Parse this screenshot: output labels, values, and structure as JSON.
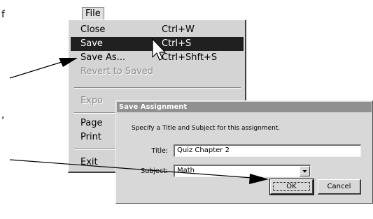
{
  "fragments": {
    "left_top": "f",
    "left_mid": ","
  },
  "menubar": {
    "file_label": "File"
  },
  "menu": {
    "items": [
      {
        "label": "Close",
        "shortcut": "Ctrl+W"
      },
      {
        "label": "Save",
        "shortcut": "Ctrl+S"
      },
      {
        "label": "Save As...",
        "shortcut": "Ctrl+Shft+S"
      },
      {
        "label": "Revert to Saved",
        "shortcut": ""
      },
      {
        "label": "Expo",
        "shortcut": ""
      },
      {
        "label": "Page",
        "shortcut": ""
      },
      {
        "label": "Print",
        "shortcut": ""
      },
      {
        "label": "Exit",
        "shortcut": ""
      }
    ],
    "highlighted": "Save",
    "disabled": [
      "Revert to Saved",
      "Expo"
    ]
  },
  "dialog": {
    "title": "Save Assignment",
    "instruction": "Specify a Title and Subject for this assignment.",
    "title_label": "Title:",
    "title_value": "Quiz Chapter 2",
    "subject_label": "Subject:",
    "subject_value": "Math",
    "ok_label": "OK",
    "cancel_label": "Cancel"
  },
  "icons": {
    "cursor": "arrow-pointer-icon",
    "dropdown": "chevron-down-icon",
    "callout": "callout-arrow"
  }
}
